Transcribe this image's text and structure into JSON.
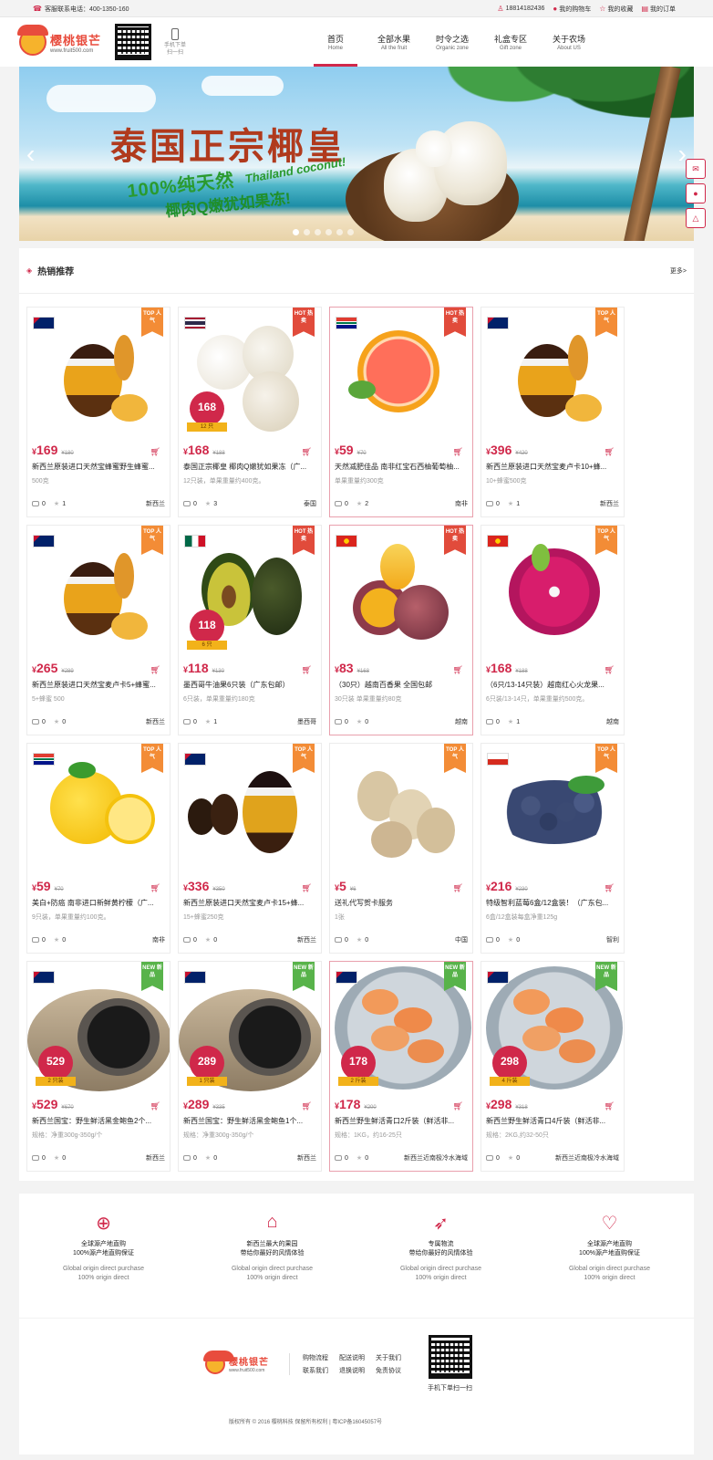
{
  "topbar": {
    "hotline": "客服联系电话：400-1350-160",
    "phone": "18814182436",
    "cart": "我的购物车",
    "favorites": "我的收藏",
    "orders": "我的订单"
  },
  "logo": {
    "name": "樱桃银芒",
    "url": "www.fruit500.com"
  },
  "mobile_caption": [
    "手机下单",
    "扫一扫"
  ],
  "nav": [
    {
      "cn": "首页",
      "en": "Home"
    },
    {
      "cn": "全部水果",
      "en": "All the fruit"
    },
    {
      "cn": "时令之选",
      "en": "Organic zone"
    },
    {
      "cn": "礼盒专区",
      "en": "Gift zone"
    },
    {
      "cn": "关于农场",
      "en": "About US"
    }
  ],
  "banner": {
    "title": "泰国正宗椰皇",
    "sub": "100%纯天然",
    "sub_en": "Thailand coconut!",
    "sub2": "椰肉Q嫩犹如果冻!"
  },
  "section": {
    "title": "热销推荐",
    "more": "更多>"
  },
  "products": [
    {
      "price": "169",
      "old": "180",
      "name": "新西兰原装进口天然宝蜂蜜野生蜂蜜...",
      "desc": "500克",
      "comments": "0",
      "likes": "1",
      "origin": "新西兰",
      "ribbon": "TOP 人气"
    },
    {
      "price": "168",
      "old": "188",
      "name": "泰国正宗椰皇 椰肉Q嫩犹如果冻（广...",
      "desc": "12只装，单果重量约400克。",
      "comments": "0",
      "likes": "3",
      "origin": "泰国",
      "ribbon": "HOT 热卖",
      "badge": "168",
      "badge_tag": "12 只"
    },
    {
      "price": "59",
      "old": "70",
      "name": "天然减肥佳品 南非红宝石西柚葡萄柚...",
      "desc": "单果重量约300克",
      "comments": "0",
      "likes": "2",
      "origin": "南非",
      "ribbon": "HOT 热卖"
    },
    {
      "price": "396",
      "old": "420",
      "name": "新西兰原装进口天然宝麦卢卡10+蜂...",
      "desc": "10+蜂蜜500克",
      "comments": "0",
      "likes": "1",
      "origin": "新西兰",
      "ribbon": "TOP 人气"
    },
    {
      "price": "265",
      "old": "289",
      "name": "新西兰原装进口天然宝麦卢卡5+蜂蜜...",
      "desc": "5+蜂蜜 500",
      "comments": "0",
      "likes": "0",
      "origin": "新西兰",
      "ribbon": "TOP 人气"
    },
    {
      "price": "118",
      "old": "130",
      "name": "墨西哥牛油果6只装（广东包邮）",
      "desc": "6只装，单果重量约180克",
      "comments": "0",
      "likes": "1",
      "origin": "墨西哥",
      "ribbon": "HOT 热卖",
      "badge": "118",
      "badge_tag": "6 只"
    },
    {
      "price": "83",
      "old": "168",
      "name": "（30只）越南百香果 全国包邮",
      "desc": "30只装 单果重量约80克",
      "comments": "0",
      "likes": "0",
      "origin": "越南",
      "ribbon": "HOT 热卖"
    },
    {
      "price": "168",
      "old": "188",
      "name": "（6只/13-14只装）越南红心火龙果...",
      "desc": "6只装/13-14只，单果重量约500克。",
      "comments": "0",
      "likes": "1",
      "origin": "越南",
      "ribbon": "TOP 人气"
    },
    {
      "price": "59",
      "old": "70",
      "name": "美白+防癌 南非进口新鲜黄柠檬（广...",
      "desc": "9只装，单果重量约100克。",
      "comments": "0",
      "likes": "0",
      "origin": "南非",
      "ribbon": "TOP 人气"
    },
    {
      "price": "336",
      "old": "350",
      "name": "新西兰原装进口天然宝麦卢卡15+蜂...",
      "desc": "15+蜂蜜250克",
      "comments": "0",
      "likes": "0",
      "origin": "新西兰",
      "ribbon": "TOP 人气"
    },
    {
      "price": "5",
      "old": "6",
      "name": "送礼代写贺卡服务",
      "desc": "1张",
      "comments": "0",
      "likes": "0",
      "origin": "中国",
      "ribbon": "TOP 人气"
    },
    {
      "price": "216",
      "old": "230",
      "name": "特级智利蓝莓6盒/12盒装！（广东包...",
      "desc": "6盒/12盒装每盒净重125g",
      "comments": "0",
      "likes": "0",
      "origin": "智利",
      "ribbon": "TOP 人气"
    },
    {
      "price": "529",
      "old": "670",
      "name": "新西兰国宝：野生鲜活黑金鲍鱼2个...",
      "desc": "规格：净重300g-350g/个",
      "comments": "0",
      "likes": "0",
      "origin": "新西兰",
      "ribbon": "NEW 新品",
      "badge": "529",
      "badge_tag": "2 只装"
    },
    {
      "price": "289",
      "old": "335",
      "name": "新西兰国宝：野生鲜活黑金鲍鱼1个...",
      "desc": "规格：净重300g-350g/个",
      "comments": "0",
      "likes": "0",
      "origin": "新西兰",
      "ribbon": "NEW 新品",
      "badge": "289",
      "badge_tag": "1 只装"
    },
    {
      "price": "178",
      "old": "200",
      "name": "新西兰野生鲜活青口2斤装（鲜活非...",
      "desc": "规格：1KG，约16-25只",
      "comments": "0",
      "likes": "0",
      "origin": "新西兰近南极冷水海域",
      "ribbon": "NEW 新品",
      "badge": "178",
      "badge_tag": "2 斤装"
    },
    {
      "price": "298",
      "old": "318",
      "name": "新西兰野生鲜活青口4斤装（鲜活非...",
      "desc": "规格：2KG,约32-50只",
      "comments": "0",
      "likes": "0",
      "origin": "新西兰近南极冷水海域",
      "ribbon": "NEW 新品",
      "badge": "298",
      "badge_tag": "4 斤装"
    }
  ],
  "features": [
    {
      "icon": "globe-icon",
      "cn1": "全球源产地直购",
      "cn2": "100%源产地直购保证",
      "en1": "Global origin direct purchase",
      "en2": "100% origin direct"
    },
    {
      "icon": "home-icon",
      "cn1": "新西兰最大的果园",
      "cn2": "带给你最好的风情体验",
      "en1": "Global origin direct purchase",
      "en2": "100% origin direct"
    },
    {
      "icon": "rocket-icon",
      "cn1": "专属物流",
      "cn2": "带给你最好的风情体验",
      "en1": "Global origin direct purchase",
      "en2": "100% origin direct"
    },
    {
      "icon": "heart-icon",
      "cn1": "全球源产地直购",
      "cn2": "100%源产地直购保证",
      "en1": "Global origin direct purchase",
      "en2": "100% origin direct"
    }
  ],
  "footer": {
    "links": [
      "购物流程",
      "配送说明",
      "关于我们",
      "联系我们",
      "退换说明",
      "免责协议"
    ],
    "qr_caption": "手机下单扫一扫",
    "copyright": "版权所有 © 2016 樱桃科技  保留所有权利 | 粤ICP备16045057号"
  },
  "colors": {
    "accent": "#d0284a",
    "top": "#f38c36",
    "hot": "#e14b3b",
    "new": "#58b34a"
  }
}
